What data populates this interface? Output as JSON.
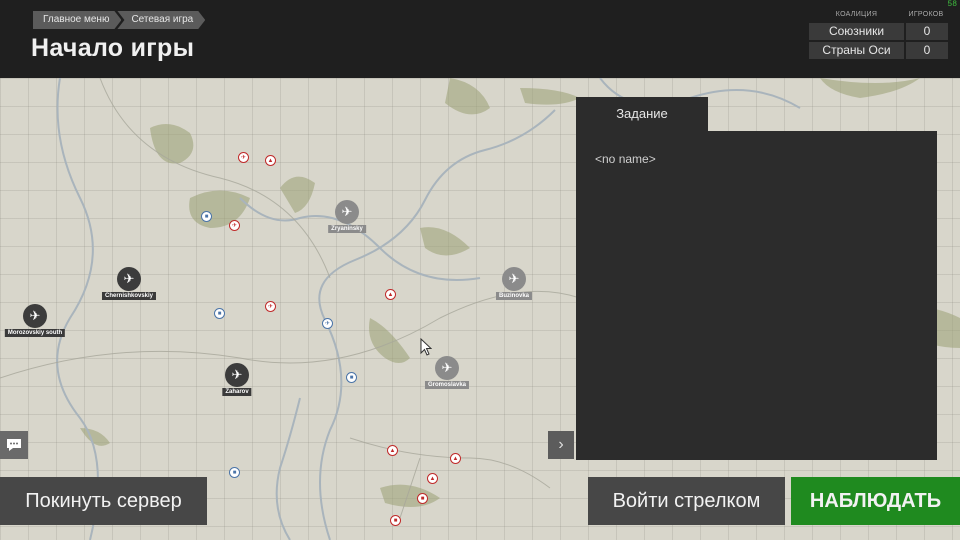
{
  "fps": "58",
  "breadcrumbs": [
    "Главное меню",
    "Сетевая игра"
  ],
  "page_title": "Начало игры",
  "coalitions": {
    "header_coalition": "КОАЛИЦИЯ",
    "header_players": "ИГРОКОВ",
    "rows": [
      {
        "name": "Союзники",
        "players": "0"
      },
      {
        "name": "Страны Оси",
        "players": "0"
      }
    ]
  },
  "map": {
    "airfields": [
      {
        "name": "Zryaninsky",
        "style": "gray"
      },
      {
        "name": "Chernishkovskiy",
        "style": "dark"
      },
      {
        "name": "Buzinovka",
        "style": "gray"
      },
      {
        "name": "Morozovskiy south",
        "style": "dark"
      },
      {
        "name": "Gromoslavka",
        "style": "gray"
      },
      {
        "name": "Zaharov",
        "style": "dark"
      }
    ],
    "colors": {
      "axis": "#c02a2a",
      "allies": "#4a74a8",
      "water": "#a9b4bc",
      "forest": "#8d9670"
    }
  },
  "mission": {
    "tab_label": "Задание",
    "name": "<no name>"
  },
  "buttons": {
    "leave": "Покинуть сервер",
    "gunner": "Войти стрелком",
    "observe": "НАБЛЮДАТЬ"
  },
  "icons": {
    "collapse": "chevron-right-icon",
    "chat": "chat-icon",
    "airfield": "plane-icon"
  }
}
